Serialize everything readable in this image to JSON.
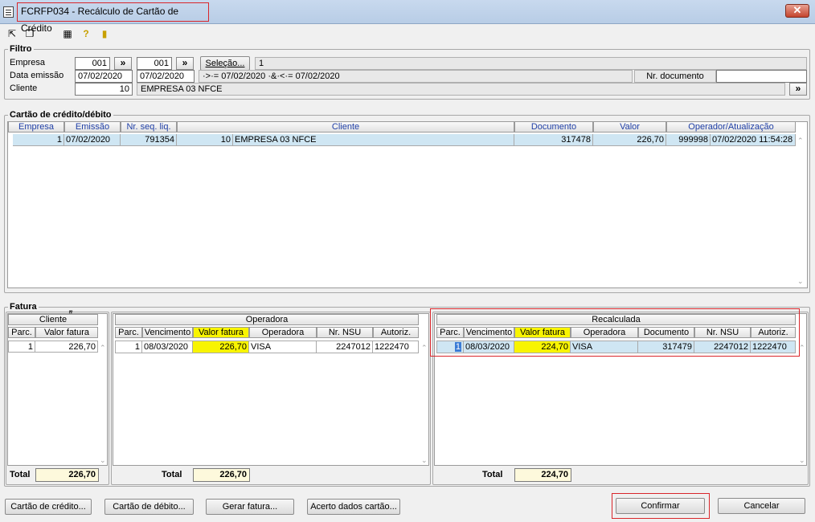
{
  "window": {
    "title": "FCRFP034 - Recálculo de Cartão de Crédito",
    "close": "✕"
  },
  "colors": {
    "accent_highlight": "#d9262b",
    "selection": "#cfe6f3",
    "yellow_header": "#f8f400"
  },
  "filter": {
    "title": "Filtro",
    "empresa_label": "Empresa",
    "empresa_from": "001",
    "empresa_to": "001",
    "selecao_label": "Seleção...",
    "selecao_value": "1",
    "data_label": "Data emissão",
    "data_from": "07/02/2020",
    "data_to": "07/02/2020",
    "data_expr": "·>·= 07/02/2020 ·&·<·= 07/02/2020",
    "nrdoc_label": "Nr. documento",
    "nrdoc_value": "",
    "cliente_label": "Cliente",
    "cliente_code": "10",
    "cliente_name": "EMPRESA 03 NFCE",
    "expand": "»"
  },
  "cartao": {
    "title": "Cartão de crédito/débito",
    "headers": [
      "Empresa",
      "Emissão",
      "Nr. seq. liq.",
      "Cliente",
      "Documento",
      "Valor",
      "Operador/Atualização"
    ],
    "row": {
      "empresa": "1",
      "emissao": "07/02/2020",
      "seq": "791354",
      "cliente_code": "10",
      "cliente_name": "EMPRESA 03 NFCE",
      "documento": "317478",
      "valor": "226,70",
      "operador": "999998",
      "atualizacao": "07/02/2020 11:54:28"
    }
  },
  "fatura": {
    "title": "Fatura",
    "cliente": {
      "title": "Cliente",
      "headers": [
        "Parc.",
        "Valor fatura"
      ],
      "row": {
        "parc": "1",
        "valor": "226,70"
      },
      "total_label": "Total",
      "total": "226,70"
    },
    "operadora": {
      "title": "Operadora",
      "headers": [
        "Parc.",
        "Vencimento",
        "Valor fatura",
        "Operadora",
        "Nr. NSU",
        "Autoriz."
      ],
      "row": {
        "parc": "1",
        "venc": "08/03/2020",
        "valor": "226,70",
        "operadora": "VISA",
        "nsu": "2247012",
        "autoriz": "1222470"
      },
      "total_label": "Total",
      "total": "226,70"
    },
    "recalculada": {
      "title": "Recalculada",
      "headers": [
        "Parc.",
        "Vencimento",
        "Valor fatura",
        "Operadora",
        "Documento",
        "Nr. NSU",
        "Autoriz."
      ],
      "row": {
        "parc": "1",
        "venc": "08/03/2020",
        "valor": "224,70",
        "operadora": "VISA",
        "documento": "317479",
        "nsu": "2247012",
        "autoriz": "1222470"
      },
      "total_label": "Total",
      "total": "224,70"
    }
  },
  "buttons": {
    "cartao_credito": "Cartão de crédito...",
    "cartao_debito": "Cartão de débito...",
    "gerar_fatura": "Gerar fatura...",
    "acerto": "Acerto dados cartão...",
    "confirmar": "Confirmar",
    "cancelar": "Cancelar"
  }
}
